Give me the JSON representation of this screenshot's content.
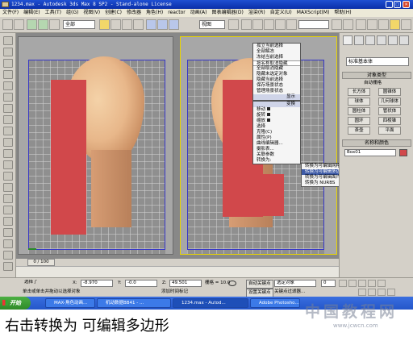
{
  "window": {
    "title": "1234.max - Autodesk 3ds Max 8 SP2 - Stand-alone License",
    "min_label": "_",
    "max_label": "□",
    "close_label": "×"
  },
  "menubar": {
    "items": [
      "文件(F)",
      "编辑(E)",
      "工具(T)",
      "组(G)",
      "视图(V)",
      "创建(C)",
      "修改器",
      "角色(H)",
      "reactor",
      "动画(A)",
      "图表编辑器(D)",
      "渲染(R)",
      "自定义(U)",
      "MAXScript(M)",
      "帮助(H)"
    ]
  },
  "toolbar": {
    "selection_filter": "全部",
    "view_coord": "视图",
    "named_set": ""
  },
  "viewports": {
    "context_menu": {
      "top_items": [
        "孤立当前选择",
        "全部解冻",
        "冻结当前选择",
        "按名称取消隐藏",
        "全部取消隐藏",
        "隐藏未选定对象",
        "隐藏当前选择",
        "保存场景状态",
        "管理场景状态"
      ],
      "quad_header": "显示",
      "quad2_header": "变换",
      "bottom_items": [
        "移动",
        "旋转",
        "缩放",
        "选择",
        "克隆(C)",
        "属性(P)",
        "曲线编辑器...",
        "摄影表...",
        "关联参数",
        "转换为:"
      ],
      "submenu_items": [
        "转换为可编辑网格",
        "转换为可编辑多边形",
        "转换为可编辑面片",
        "转换为 NURBS"
      ]
    }
  },
  "command_panel": {
    "dropdown": "标准基本体",
    "object_type_title": "对象类型",
    "autogrid": "自动栅格",
    "buttons": [
      "长方体",
      "圆锥体",
      "球体",
      "几何球体",
      "圆柱体",
      "管状体",
      "圆环",
      "四棱锥",
      "茶壶",
      "平面"
    ],
    "name_color_title": "名称和颜色",
    "name_value": "Box01"
  },
  "timeline": {
    "frame_label": "0 / 100"
  },
  "status": {
    "selected": "选择了 1",
    "x_label": "X:",
    "x_value": "-8.970",
    "y_label": "Y:",
    "y_value": "-0.0",
    "z_label": "Z:",
    "z_value": "49.501",
    "grid": "栅格 = 10.0",
    "autokey": "自动关键点",
    "selected_obj": "选定对象",
    "setkey": "设置关键点",
    "keyfilter": "关键点过滤器...",
    "prompt": "单击或单击并拖动以选择对象",
    "add_time_tag": "添加时间标记",
    "frame_number": "0"
  },
  "taskbar": {
    "start": "开始",
    "tasks": [
      "MAX-角色动画...",
      "机动数据BB41 - ...",
      "1234.max - Autod...",
      "Adobe Photosho..."
    ]
  },
  "caption": {
    "text": "右击转换为 可编辑多边形"
  },
  "watermark": {
    "main": "中国教程网",
    "url": "www.jcwcn.com"
  }
}
